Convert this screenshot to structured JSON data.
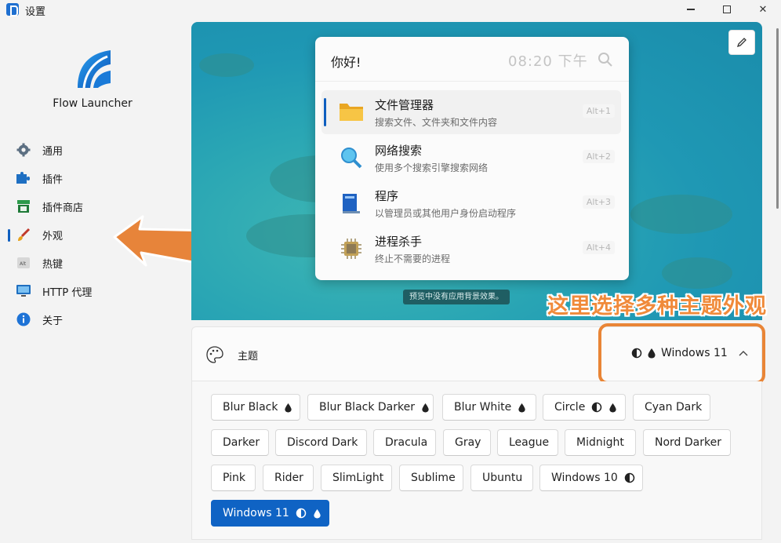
{
  "window": {
    "title": "设置",
    "minimize": "minimize",
    "maximize": "maximize",
    "close": "✕"
  },
  "sidebar": {
    "app_name": "Flow Launcher",
    "items": [
      {
        "label": "通用",
        "icon": "gear-icon"
      },
      {
        "label": "插件",
        "icon": "puzzle-icon"
      },
      {
        "label": "插件商店",
        "icon": "store-icon"
      },
      {
        "label": "外观",
        "icon": "brush-icon",
        "selected": true
      },
      {
        "label": "热键",
        "icon": "keyboard-icon"
      },
      {
        "label": "HTTP 代理",
        "icon": "monitor-icon"
      },
      {
        "label": "关于",
        "icon": "info-icon"
      }
    ]
  },
  "preview": {
    "query": "你好!",
    "clock": "08:20 下午",
    "results": [
      {
        "title": "文件管理器",
        "subtitle": "搜索文件、文件夹和文件内容",
        "hotkey": "Alt+1",
        "icon": "folder-icon"
      },
      {
        "title": "网络搜索",
        "subtitle": "使用多个搜索引擎搜索网络",
        "hotkey": "Alt+2",
        "icon": "magnifier-icon"
      },
      {
        "title": "程序",
        "subtitle": "以管理员或其他用户身份启动程序",
        "hotkey": "Alt+3",
        "icon": "program-icon"
      },
      {
        "title": "进程杀手",
        "subtitle": "终止不需要的进程",
        "hotkey": "Alt+4",
        "icon": "cpu-icon"
      }
    ],
    "note": "预览中没有应用背景效果。"
  },
  "annotation": "这里选择多种主题外观",
  "theme": {
    "label": "主题",
    "current": "Windows 11",
    "options": [
      {
        "name": "Blur Black",
        "glyphs": [
          "drop"
        ]
      },
      {
        "name": "Blur Black Darker",
        "glyphs": [
          "drop"
        ]
      },
      {
        "name": "Blur White",
        "glyphs": [
          "drop"
        ]
      },
      {
        "name": "Circle",
        "glyphs": [
          "contrast",
          "drop"
        ]
      },
      {
        "name": "Cyan Dark",
        "glyphs": []
      },
      {
        "name": "Darker",
        "glyphs": []
      },
      {
        "name": "Discord Dark",
        "glyphs": []
      },
      {
        "name": "Dracula",
        "glyphs": []
      },
      {
        "name": "Gray",
        "glyphs": []
      },
      {
        "name": "League",
        "glyphs": []
      },
      {
        "name": "Midnight",
        "glyphs": []
      },
      {
        "name": "Nord Darker",
        "glyphs": []
      },
      {
        "name": "Pink",
        "glyphs": []
      },
      {
        "name": "Rider",
        "glyphs": []
      },
      {
        "name": "SlimLight",
        "glyphs": []
      },
      {
        "name": "Sublime",
        "glyphs": []
      },
      {
        "name": "Ubuntu",
        "glyphs": []
      },
      {
        "name": "Windows 10",
        "glyphs": [
          "contrast"
        ]
      },
      {
        "name": "Windows 11",
        "glyphs": [
          "contrast",
          "drop"
        ],
        "selected": true
      }
    ]
  },
  "colors": {
    "accent": "#0f63c4",
    "annotation": "#e98536"
  }
}
